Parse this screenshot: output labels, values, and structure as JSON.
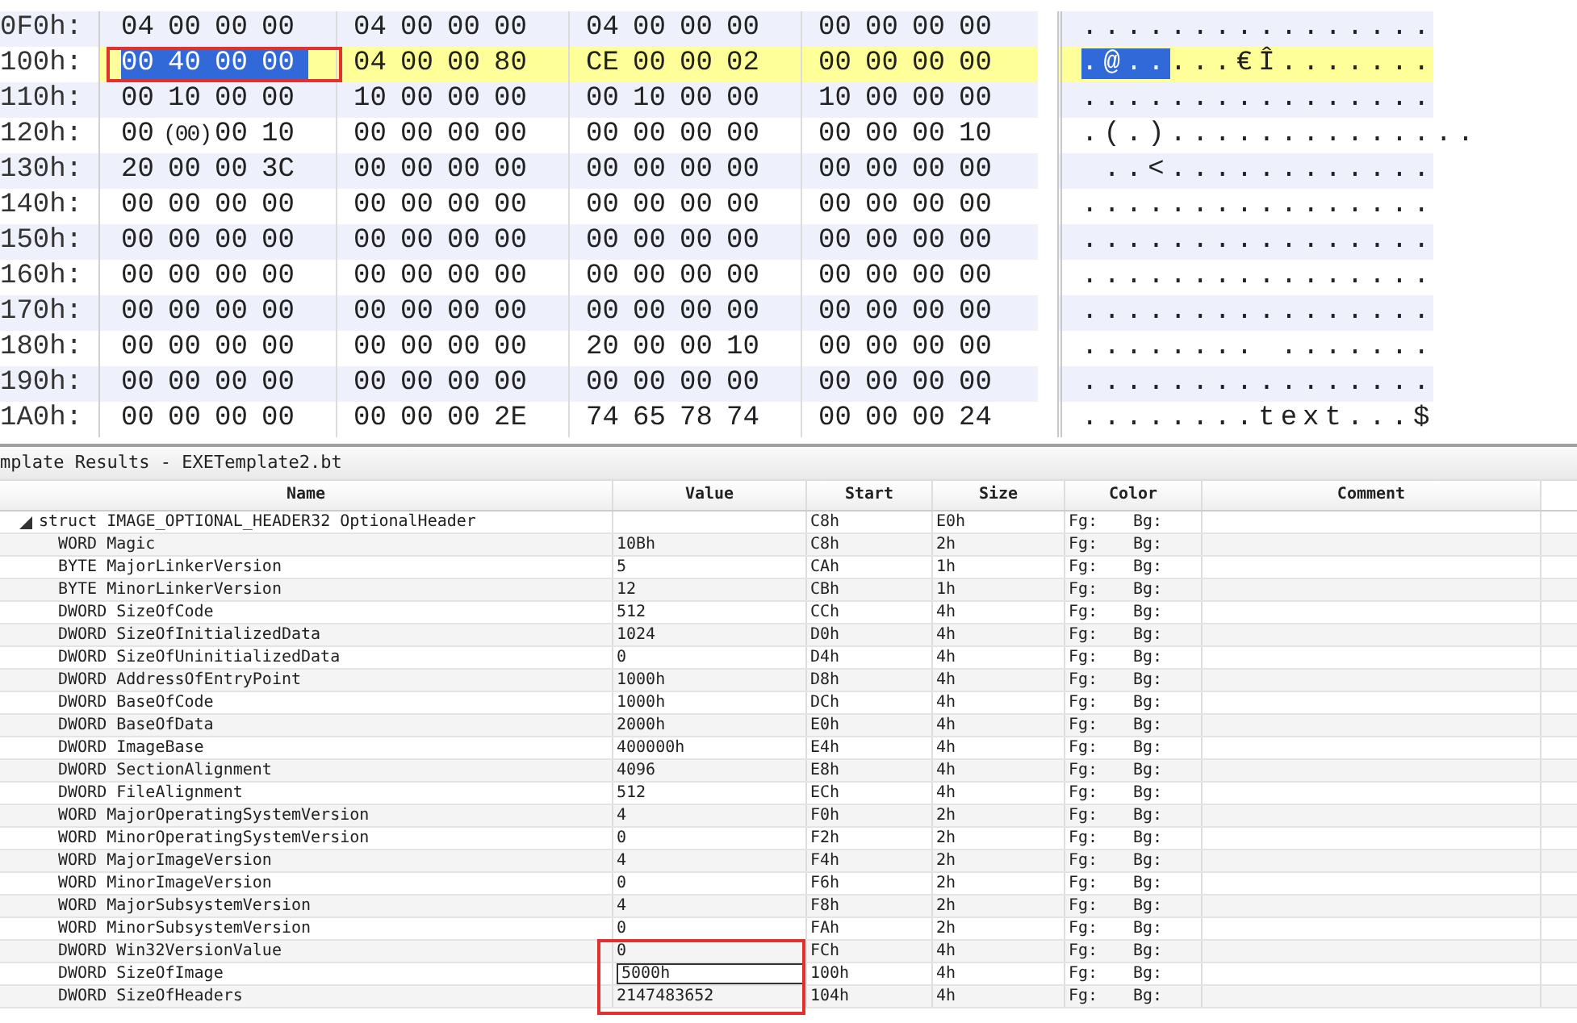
{
  "hex_view": {
    "rows": [
      {
        "address": "0F0h:",
        "highlighted": false,
        "bytes": [
          "04",
          "00",
          "00",
          "00",
          "04",
          "00",
          "00",
          "00",
          "04",
          "00",
          "00",
          "00",
          "00",
          "00",
          "00",
          "00"
        ],
        "ascii": "................"
      },
      {
        "address": "100h:",
        "highlighted": true,
        "selected_bytes": [
          "00",
          "40",
          "00",
          "00"
        ],
        "bytes": [
          "04",
          "00",
          "00",
          "80",
          "CE",
          "00",
          "00",
          "02",
          "00",
          "00",
          "00",
          "00"
        ],
        "ascii_selected": ".@..",
        "ascii": "...€Î......."
      },
      {
        "address": "110h:",
        "highlighted": false,
        "bytes": [
          "00",
          "10",
          "00",
          "00",
          "10",
          "00",
          "00",
          "00",
          "00",
          "10",
          "00",
          "00",
          "10",
          "00",
          "00",
          "00"
        ],
        "ascii": "................"
      },
      {
        "address": "120h:",
        "highlighted": false,
        "bytes": [
          "00",
          "(00)",
          "00",
          "10",
          "00",
          "00",
          "00",
          "00",
          "00",
          "00",
          "00",
          "00",
          "00",
          "00",
          "00",
          "10"
        ],
        "ascii": ".(.).............."
      },
      {
        "address": "130h:",
        "highlighted": false,
        "bytes": [
          "20",
          "00",
          "00",
          "3C",
          "00",
          "00",
          "00",
          "00",
          "00",
          "00",
          "00",
          "00",
          "00",
          "00",
          "00",
          "00"
        ],
        "ascii": " ..<............"
      },
      {
        "address": "140h:",
        "highlighted": false,
        "bytes": [
          "00",
          "00",
          "00",
          "00",
          "00",
          "00",
          "00",
          "00",
          "00",
          "00",
          "00",
          "00",
          "00",
          "00",
          "00",
          "00"
        ],
        "ascii": "................"
      },
      {
        "address": "150h:",
        "highlighted": false,
        "bytes": [
          "00",
          "00",
          "00",
          "00",
          "00",
          "00",
          "00",
          "00",
          "00",
          "00",
          "00",
          "00",
          "00",
          "00",
          "00",
          "00"
        ],
        "ascii": "................"
      },
      {
        "address": "160h:",
        "highlighted": false,
        "bytes": [
          "00",
          "00",
          "00",
          "00",
          "00",
          "00",
          "00",
          "00",
          "00",
          "00",
          "00",
          "00",
          "00",
          "00",
          "00",
          "00"
        ],
        "ascii": "................"
      },
      {
        "address": "170h:",
        "highlighted": false,
        "bytes": [
          "00",
          "00",
          "00",
          "00",
          "00",
          "00",
          "00",
          "00",
          "00",
          "00",
          "00",
          "00",
          "00",
          "00",
          "00",
          "00"
        ],
        "ascii": "................"
      },
      {
        "address": "180h:",
        "highlighted": false,
        "bytes": [
          "00",
          "00",
          "00",
          "00",
          "00",
          "00",
          "00",
          "00",
          "20",
          "00",
          "00",
          "10",
          "00",
          "00",
          "00",
          "00"
        ],
        "ascii": "........ ......."
      },
      {
        "address": "190h:",
        "highlighted": false,
        "bytes": [
          "00",
          "00",
          "00",
          "00",
          "00",
          "00",
          "00",
          "00",
          "00",
          "00",
          "00",
          "00",
          "00",
          "00",
          "00",
          "00"
        ],
        "ascii": "................"
      },
      {
        "address": "1A0h:",
        "highlighted": false,
        "bytes": [
          "00",
          "00",
          "00",
          "00",
          "00",
          "00",
          "00",
          "2E",
          "74",
          "65",
          "78",
          "74",
          "00",
          "00",
          "00",
          "24"
        ],
        "ascii": "........text...$"
      }
    ]
  },
  "template_results": {
    "title": "mplate Results - EXETemplate2.bt",
    "columns": [
      "Name",
      "Value",
      "Start",
      "Size",
      "Color",
      "Comment"
    ],
    "rows": [
      {
        "name": "struct IMAGE_OPTIONAL_HEADER32 OptionalHeader",
        "expanded": true,
        "start": "C8h",
        "size": "E0h",
        "fg": "Fg:",
        "bg": "Bg:",
        "children": [
          {
            "name": "WORD Magic",
            "value": "10Bh",
            "editing": false,
            "start": "C8h",
            "size": "2h",
            "fg": "Fg:",
            "bg": "Bg:"
          },
          {
            "name": "BYTE MajorLinkerVersion",
            "value": "5",
            "editing": false,
            "start": "CAh",
            "size": "1h",
            "fg": "Fg:",
            "bg": "Bg:"
          },
          {
            "name": "BYTE MinorLinkerVersion",
            "value": "12",
            "editing": false,
            "start": "CBh",
            "size": "1h",
            "fg": "Fg:",
            "bg": "Bg:"
          },
          {
            "name": "DWORD SizeOfCode",
            "value": "512",
            "editing": false,
            "start": "CCh",
            "size": "4h",
            "fg": "Fg:",
            "bg": "Bg:"
          },
          {
            "name": "DWORD SizeOfInitializedData",
            "value": "1024",
            "editing": false,
            "start": "D0h",
            "size": "4h",
            "fg": "Fg:",
            "bg": "Bg:"
          },
          {
            "name": "DWORD SizeOfUninitializedData",
            "value": "0",
            "editing": false,
            "start": "D4h",
            "size": "4h",
            "fg": "Fg:",
            "bg": "Bg:"
          },
          {
            "name": "DWORD AddressOfEntryPoint",
            "value": "1000h",
            "editing": false,
            "start": "D8h",
            "size": "4h",
            "fg": "Fg:",
            "bg": "Bg:"
          },
          {
            "name": "DWORD BaseOfCode",
            "value": "1000h",
            "editing": false,
            "start": "DCh",
            "size": "4h",
            "fg": "Fg:",
            "bg": "Bg:"
          },
          {
            "name": "DWORD BaseOfData",
            "value": "2000h",
            "editing": false,
            "start": "E0h",
            "size": "4h",
            "fg": "Fg:",
            "bg": "Bg:"
          },
          {
            "name": "DWORD ImageBase",
            "value": "400000h",
            "editing": false,
            "start": "E4h",
            "size": "4h",
            "fg": "Fg:",
            "bg": "Bg:"
          },
          {
            "name": "DWORD SectionAlignment",
            "value": "4096",
            "editing": false,
            "start": "E8h",
            "size": "4h",
            "fg": "Fg:",
            "bg": "Bg:"
          },
          {
            "name": "DWORD FileAlignment",
            "value": "512",
            "editing": false,
            "start": "ECh",
            "size": "4h",
            "fg": "Fg:",
            "bg": "Bg:"
          },
          {
            "name": "WORD MajorOperatingSystemVersion",
            "value": "4",
            "editing": false,
            "start": "F0h",
            "size": "2h",
            "fg": "Fg:",
            "bg": "Bg:"
          },
          {
            "name": "WORD MinorOperatingSystemVersion",
            "value": "0",
            "editing": false,
            "start": "F2h",
            "size": "2h",
            "fg": "Fg:",
            "bg": "Bg:"
          },
          {
            "name": "WORD MajorImageVersion",
            "value": "4",
            "editing": false,
            "start": "F4h",
            "size": "2h",
            "fg": "Fg:",
            "bg": "Bg:"
          },
          {
            "name": "WORD MinorImageVersion",
            "value": "0",
            "editing": false,
            "start": "F6h",
            "size": "2h",
            "fg": "Fg:",
            "bg": "Bg:"
          },
          {
            "name": "WORD MajorSubsystemVersion",
            "value": "4",
            "editing": false,
            "start": "F8h",
            "size": "2h",
            "fg": "Fg:",
            "bg": "Bg:"
          },
          {
            "name": "WORD MinorSubsystemVersion",
            "value": "0",
            "editing": false,
            "start": "FAh",
            "size": "2h",
            "fg": "Fg:",
            "bg": "Bg:"
          },
          {
            "name": "DWORD Win32VersionValue",
            "value": "0",
            "editing": false,
            "start": "FCh",
            "size": "4h",
            "fg": "Fg:",
            "bg": "Bg:"
          },
          {
            "name": "DWORD SizeOfImage",
            "value": "5000h",
            "editing": true,
            "start": "100h",
            "size": "4h",
            "fg": "Fg:",
            "bg": "Bg:"
          },
          {
            "name": "DWORD SizeOfHeaders",
            "value": "2147483652",
            "editing": false,
            "start": "104h",
            "size": "4h",
            "fg": "Fg:",
            "bg": "Bg:"
          }
        ]
      }
    ]
  }
}
